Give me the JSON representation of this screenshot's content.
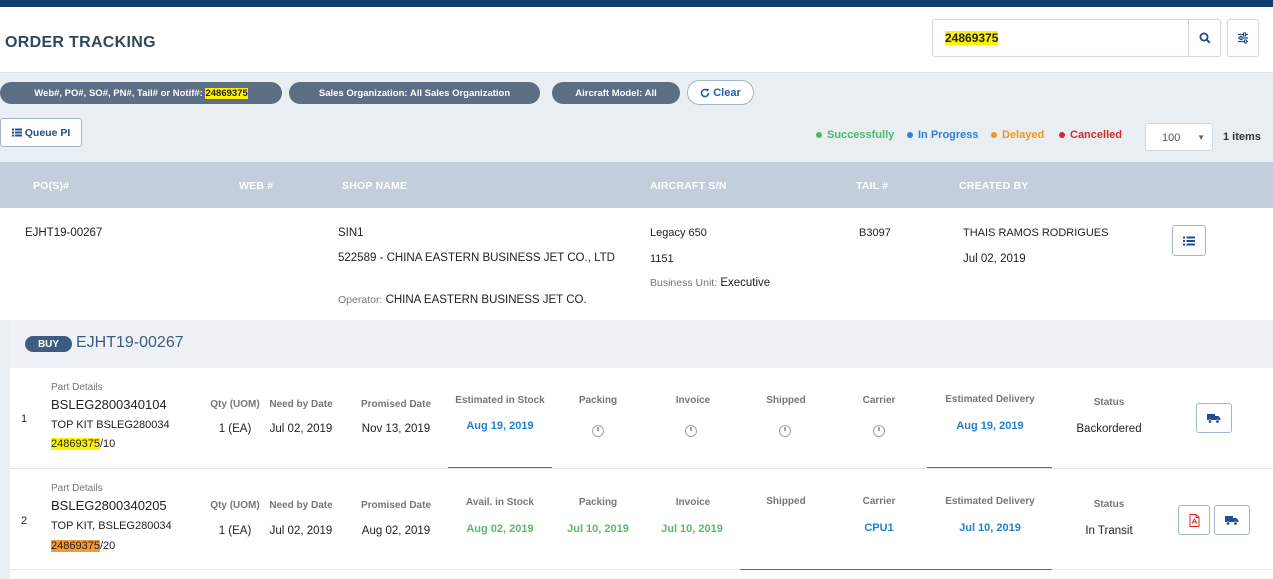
{
  "header": {
    "title": "ORDER TRACKING",
    "search_value": "24869375"
  },
  "filters": {
    "chip1_label": "Web#, PO#, SO#, PN#, Tail# or Notif#:",
    "chip1_value": "24869375",
    "chip2": "Sales Organization: All Sales Organization",
    "chip3": "Aircraft Model: All",
    "clear_label": "Clear"
  },
  "toolbar": {
    "queue_label": "Queue PI",
    "legend": [
      {
        "label": "Successfully",
        "color": "#4cb86a"
      },
      {
        "label": "In Progress",
        "color": "#2f80d6"
      },
      {
        "label": "Delayed",
        "color": "#f0971f"
      },
      {
        "label": "Cancelled",
        "color": "#d62a2a"
      }
    ],
    "per_page": "100",
    "items_count": "1 items"
  },
  "table": {
    "columns": [
      "PO(S)#",
      "WEB #",
      "SHOP NAME",
      "AIRCRAFT S/N",
      "TAIL #",
      "CREATED BY"
    ]
  },
  "order": {
    "po": "EJHT19-00267",
    "shop_code": "SIN1",
    "shop_name": "522589 - CHINA EASTERN BUSINESS JET CO., LTD",
    "operator_label": "Operator:",
    "operator": "CHINA EASTERN BUSINESS JET CO.",
    "aircraft": "Legacy 650",
    "serial": "1151",
    "bu_label": "Business Unit:",
    "bu_value": "Executive",
    "tail": "B3097",
    "created_by": "THAIS RAMOS RODRIGUES",
    "created_date": "Jul 02, 2019"
  },
  "detail": {
    "badge": "BUY",
    "po": "EJHT19-00267",
    "lines": [
      {
        "index": "1",
        "part_label": "Part Details",
        "part_number": "BSLEG2800340104",
        "description": "TOP KIT BSLEG280034",
        "ref_hl": "24869375",
        "ref_suffix": "/10",
        "qty_label": "Qty (UOM)",
        "qty": "1 (EA)",
        "need_label": "Need by Date",
        "need": "Jul 02, 2019",
        "promised_label": "Promised Date",
        "promised": "Nov 13, 2019",
        "stock_label": "Estimated in Stock",
        "stock": "Aug 19, 2019",
        "packing_label": "Packing",
        "packing": "",
        "invoice_label": "Invoice",
        "invoice": "",
        "shipped_label": "Shipped",
        "shipped": "",
        "carrier_label": "Carrier",
        "carrier": "",
        "delivery_label": "Estimated Delivery",
        "delivery": "Aug 19, 2019",
        "status_label": "Status",
        "status": "Backordered"
      },
      {
        "index": "2",
        "part_label": "Part Details",
        "part_number": "BSLEG2800340205",
        "description": "TOP KIT, BSLEG280034",
        "ref_hl": "24869375",
        "ref_suffix": "/20",
        "qty_label": "Qty (UOM)",
        "qty": "1 (EA)",
        "need_label": "Need by Date",
        "need": "Jul 02, 2019",
        "promised_label": "Promised Date",
        "promised": "Aug 02, 2019",
        "stock_label": "Avail. in Stock",
        "stock": "Aug 02, 2019",
        "packing_label": "Packing",
        "packing": "Jul 10, 2019",
        "invoice_label": "Invoice",
        "invoice": "Jul 10, 2019",
        "shipped_label": "Shipped",
        "shipped": "",
        "carrier_label": "Carrier",
        "carrier": "CPU1",
        "delivery_label": "Estimated Delivery",
        "delivery": "Jul 10, 2019",
        "status_label": "Status",
        "status": "In Transit"
      }
    ]
  }
}
